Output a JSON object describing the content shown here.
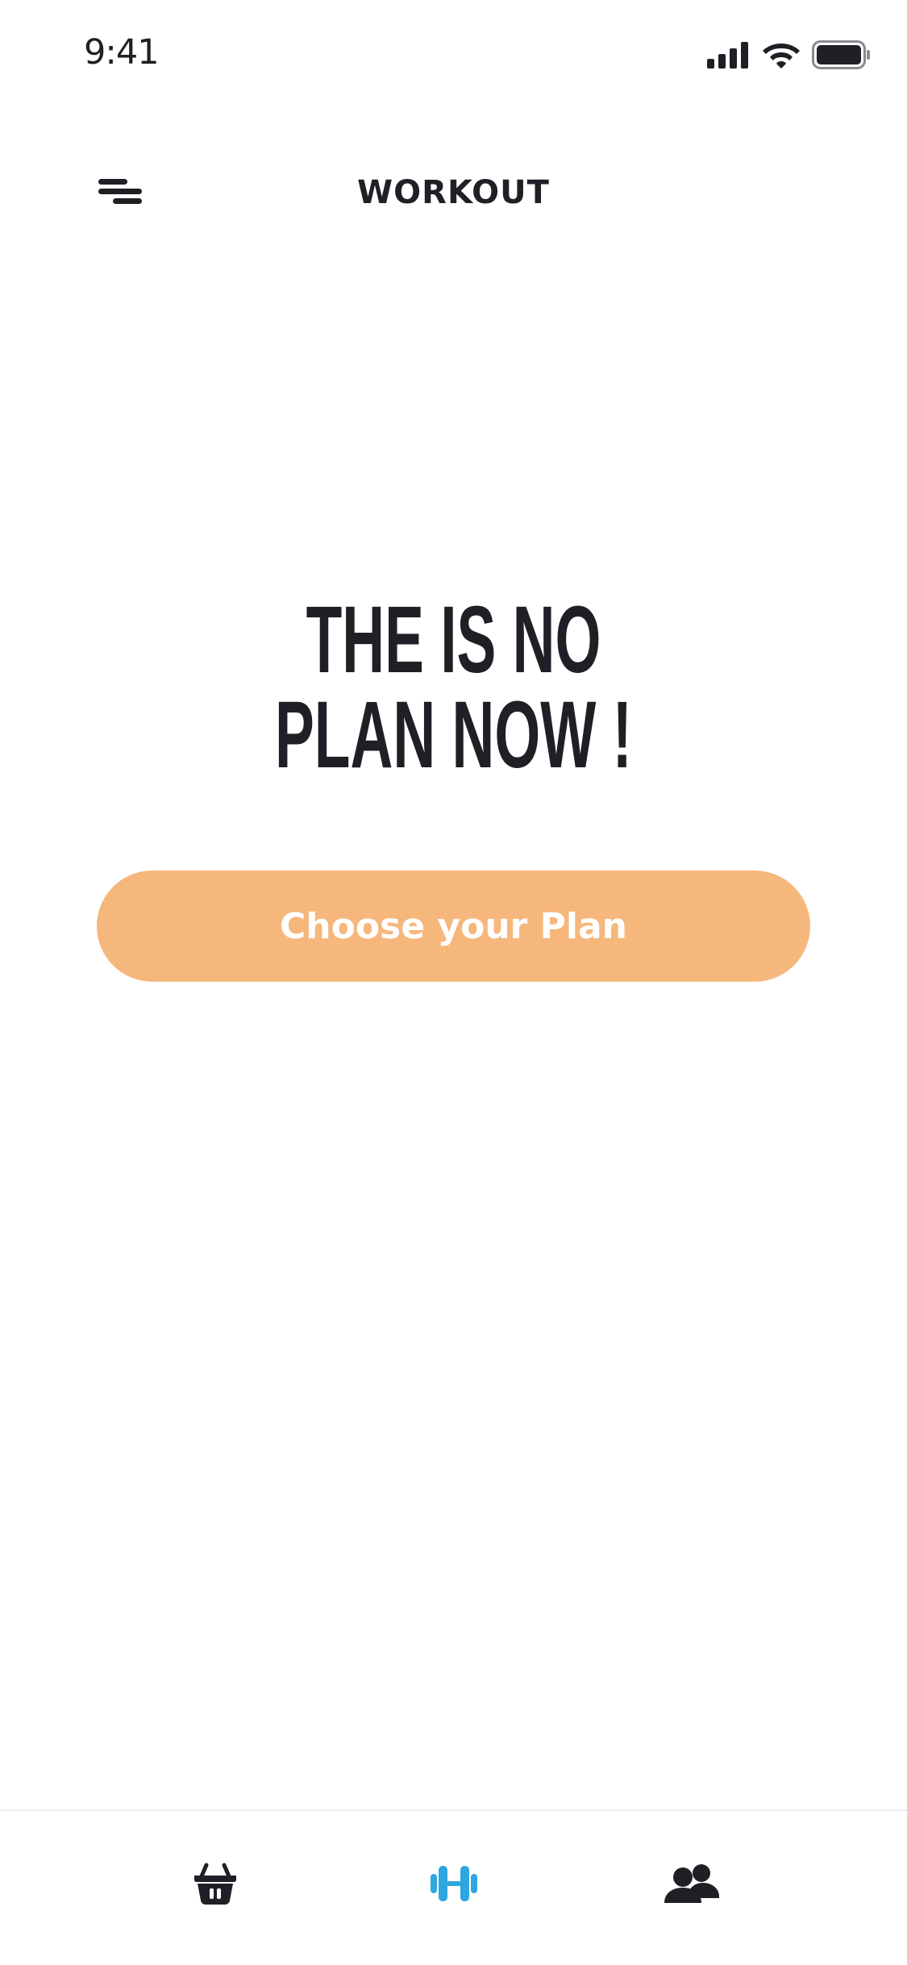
{
  "status_bar": {
    "time": "9:41",
    "icons": [
      "cellular-signal-icon",
      "wifi-icon",
      "battery-icon"
    ]
  },
  "header": {
    "title": "WORKOUT",
    "menu_icon": "menu-icon"
  },
  "empty_state": {
    "line1": "THE IS NO",
    "line2": "PLAN NOW !",
    "button_label": "Choose your Plan"
  },
  "bottom_nav": {
    "items": [
      {
        "icon": "basket-icon",
        "active": false
      },
      {
        "icon": "dumbbell-icon",
        "active": true
      },
      {
        "icon": "users-icon",
        "active": false
      }
    ]
  },
  "colors": {
    "text": "#1f2025",
    "accent_button": "#f6b77c",
    "active_nav": "#2ea6e0",
    "divider": "#ececee",
    "background": "#ffffff"
  }
}
